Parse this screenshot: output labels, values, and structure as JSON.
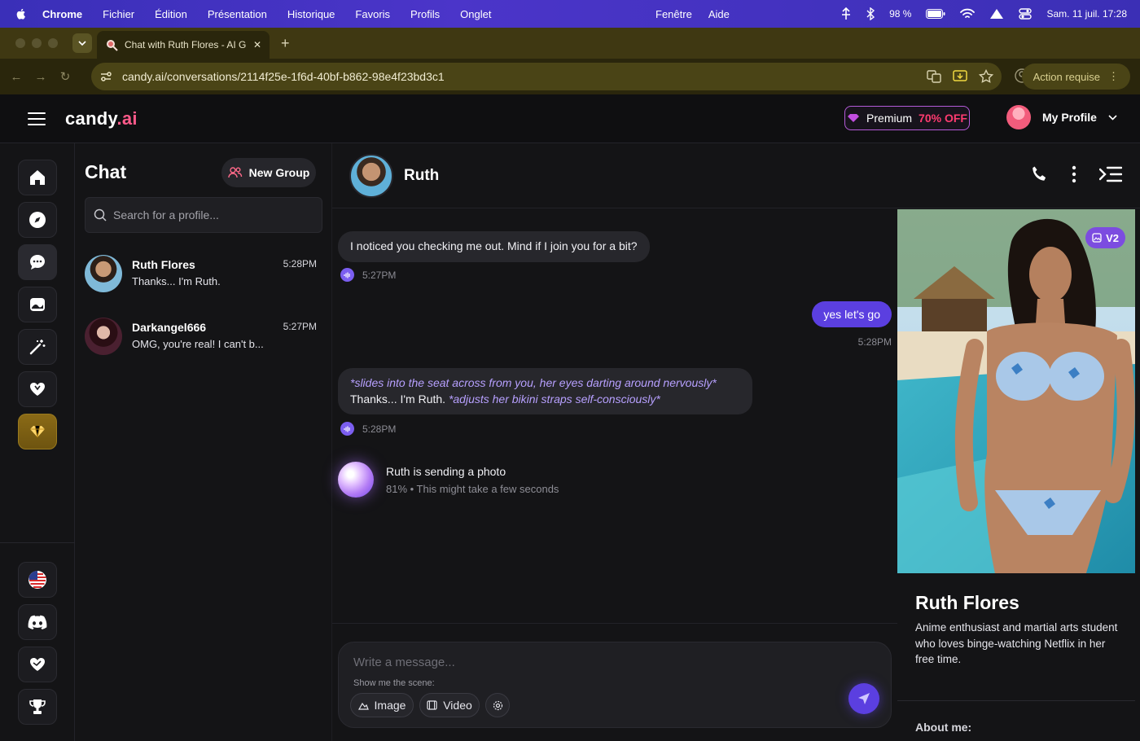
{
  "menubar": {
    "items": [
      "Chrome",
      "Fichier",
      "Édition",
      "Présentation",
      "Historique",
      "Favoris",
      "Profils",
      "Onglet"
    ],
    "center_items": [
      "Fenêtre",
      "Aide"
    ],
    "battery": "98 %",
    "datetime": "Sam. 11 juil.  17:28"
  },
  "browser": {
    "tab_title": "Chat with Ruth Flores - AI Girlfriend",
    "url": "candy.ai/conversations/2114f25e-1f6d-40bf-b862-98e4f23bd3c1",
    "action_label": "Action requise"
  },
  "site": {
    "logo_main": "candy",
    "logo_suffix": ".ai",
    "premium_label": "Premium",
    "premium_off": "70% OFF",
    "profile_label": "My Profile"
  },
  "chatlist": {
    "title": "Chat",
    "new_group": "New Group",
    "search_placeholder": "Search for a profile...",
    "conversations": [
      {
        "name": "Ruth Flores",
        "time": "5:28PM",
        "preview": "Thanks... I'm Ruth."
      },
      {
        "name": "Darkangel666",
        "time": "5:27PM",
        "preview": "OMG, you're real! I can't b..."
      }
    ]
  },
  "chat": {
    "contact_name": "Ruth",
    "messages": [
      {
        "from": "ai",
        "text": "I noticed you checking me out. Mind if I join you for a bit?",
        "time": "5:27PM"
      },
      {
        "from": "user",
        "text": "yes let's go",
        "time": "5:28PM"
      },
      {
        "from": "ai",
        "action1": "*slides into the seat across from you, her eyes darting around nervously*",
        "text": "Thanks... I'm Ruth.",
        "action2": "*adjusts her bikini straps self-consciously*",
        "time": "5:28PM"
      }
    ],
    "sending_title": "Ruth is sending a photo",
    "sending_progress": "81% • This might take a few seconds",
    "composer_placeholder": "Write a message...",
    "scene_label": "Show me the scene:",
    "chip_image": "Image",
    "chip_video": "Video"
  },
  "profile": {
    "badge": "V2",
    "name": "Ruth Flores",
    "description": "Anime enthusiast and martial arts student who loves binge-watching Netflix in her free time.",
    "about_label": "About me:"
  }
}
